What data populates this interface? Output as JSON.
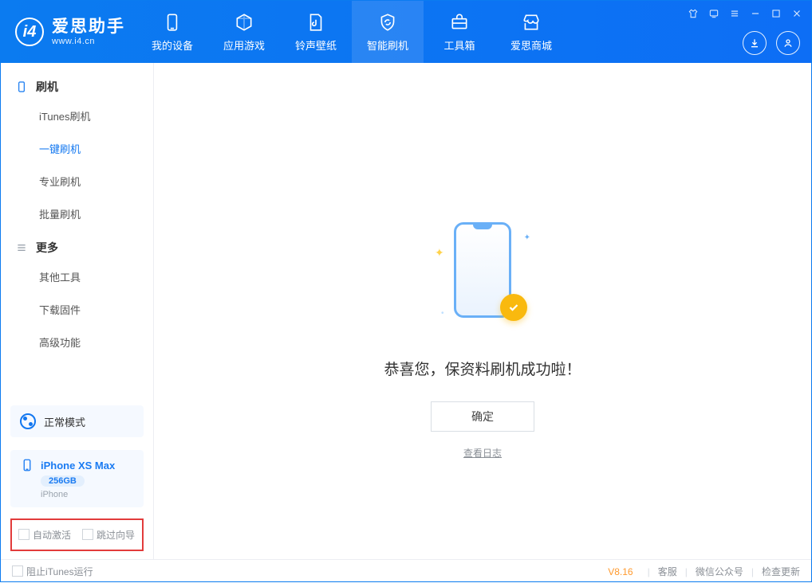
{
  "app": {
    "title": "爱思助手",
    "subtitle": "www.i4.cn"
  },
  "nav": {
    "items": [
      {
        "label": "我的设备"
      },
      {
        "label": "应用游戏"
      },
      {
        "label": "铃声壁纸"
      },
      {
        "label": "智能刷机"
      },
      {
        "label": "工具箱"
      },
      {
        "label": "爱思商城"
      }
    ],
    "active_index": 3
  },
  "sidebar": {
    "group1": {
      "title": "刷机",
      "items": [
        "iTunes刷机",
        "一键刷机",
        "专业刷机",
        "批量刷机"
      ],
      "active_index": 1
    },
    "group2": {
      "title": "更多",
      "items": [
        "其他工具",
        "下载固件",
        "高级功能"
      ]
    }
  },
  "mode": {
    "label": "正常模式"
  },
  "device": {
    "name": "iPhone XS Max",
    "capacity": "256GB",
    "type": "iPhone"
  },
  "checkboxes": {
    "auto_activate": "自动激活",
    "skip_guide": "跳过向导"
  },
  "main": {
    "success_message": "恭喜您，保资料刷机成功啦！",
    "ok_label": "确定",
    "log_link": "查看日志"
  },
  "footer": {
    "block_itunes": "阻止iTunes运行",
    "version": "V8.16",
    "links": [
      "客服",
      "微信公众号",
      "检查更新"
    ]
  }
}
